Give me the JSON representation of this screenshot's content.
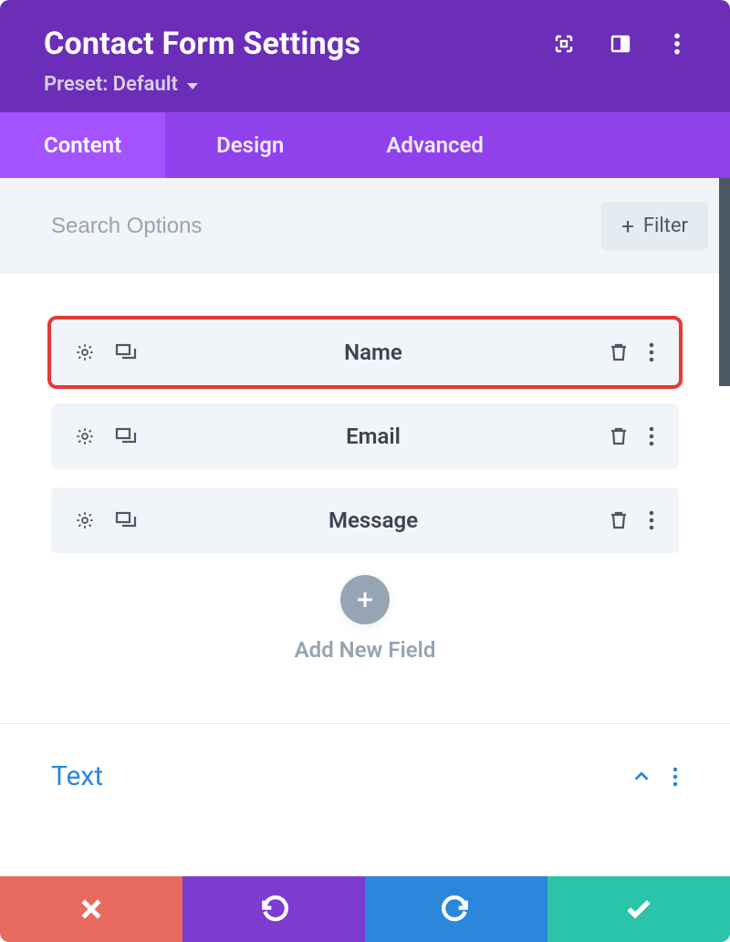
{
  "header": {
    "title": "Contact Form Settings",
    "preset_label": "Preset: Default"
  },
  "tabs": {
    "items": [
      {
        "label": "Content",
        "active": true
      },
      {
        "label": "Design",
        "active": false
      },
      {
        "label": "Advanced",
        "active": false
      }
    ]
  },
  "search": {
    "placeholder": "Search Options",
    "filter_label": "Filter"
  },
  "fields": {
    "items": [
      {
        "label": "Name",
        "highlight": true
      },
      {
        "label": "Email",
        "highlight": false
      },
      {
        "label": "Message",
        "highlight": false
      }
    ],
    "add_label": "Add New Field"
  },
  "section": {
    "title": "Text"
  }
}
